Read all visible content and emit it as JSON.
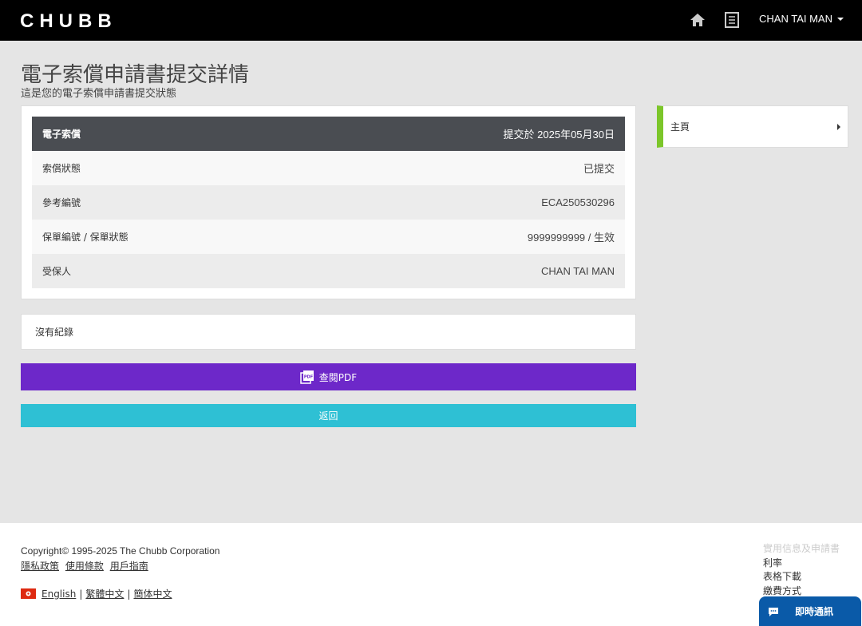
{
  "header": {
    "logo_text": "CHUBB",
    "user_name": "CHAN TAI MAN",
    "icons": [
      "home-icon",
      "document-list-icon",
      "caret-down-icon"
    ]
  },
  "page": {
    "title": "電子索償申請書提交詳情",
    "subtitle": "這是您的電子索償申請書提交狀態"
  },
  "claim": {
    "header_label": "電子索償",
    "submitted_text": "提交於 2025年05月30日",
    "rows": [
      {
        "label": "索償狀態",
        "value": "已提交"
      },
      {
        "label": "參考編號",
        "value": "ECA250530296"
      },
      {
        "label": "保單編號 / 保單狀態",
        "value": "9999999999 / 生效"
      },
      {
        "label": "受保人",
        "value": "CHAN TAI MAN"
      }
    ]
  },
  "no_record": "沒有紀錄",
  "buttons": {
    "view_pdf": "查閱PDF",
    "back": "返回"
  },
  "sidebar": {
    "items": [
      {
        "label": "主頁"
      }
    ]
  },
  "footer": {
    "copyright": "Copyright© 1995-2025 The Chubb Corporation",
    "legal_links": [
      "隱私政策",
      "使用條款",
      "用戶指南"
    ],
    "languages": [
      "English",
      "繁體中文",
      "簡体中文"
    ],
    "language_separator": "|",
    "right_links": [
      "實用信息及申請書",
      "利率",
      "表格下載",
      "繳費方式"
    ]
  },
  "chat": {
    "label": "即時通訊"
  },
  "colors": {
    "header_bg": "#000000",
    "table_head_bg": "#4a4d52",
    "pdf_button": "#6d28c9",
    "back_button": "#2ec0d4",
    "sidebar_accent": "#7cc62a",
    "chat_bg": "#0a5aa8"
  }
}
